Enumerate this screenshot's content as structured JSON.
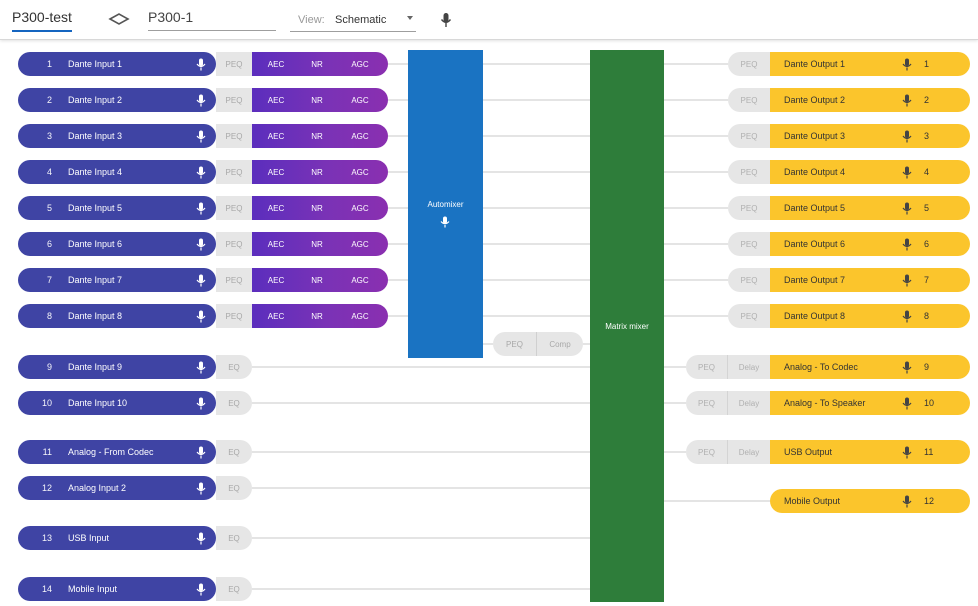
{
  "topbar": {
    "device": "P300-test",
    "name": "P300-1",
    "view_label": "View:",
    "view_value": "Schematic"
  },
  "colors": {
    "input": "#3f44a4",
    "fx": "#7a32b6",
    "automixer": "#1a73c2",
    "matrix": "#2e7d3a",
    "output": "#fbc52c"
  },
  "inputs": [
    {
      "num": "1",
      "name": "Dante Input 1",
      "proc": "PEQ"
    },
    {
      "num": "2",
      "name": "Dante Input 2",
      "proc": "PEQ"
    },
    {
      "num": "3",
      "name": "Dante Input 3",
      "proc": "PEQ"
    },
    {
      "num": "4",
      "name": "Dante Input 4",
      "proc": "PEQ"
    },
    {
      "num": "5",
      "name": "Dante Input 5",
      "proc": "PEQ"
    },
    {
      "num": "6",
      "name": "Dante Input 6",
      "proc": "PEQ"
    },
    {
      "num": "7",
      "name": "Dante Input 7",
      "proc": "PEQ"
    },
    {
      "num": "8",
      "name": "Dante Input 8",
      "proc": "PEQ"
    },
    {
      "num": "9",
      "name": "Dante Input 9",
      "proc": "EQ"
    },
    {
      "num": "10",
      "name": "Dante Input 10",
      "proc": "EQ"
    },
    {
      "num": "11",
      "name": "Analog - From Codec",
      "proc": "EQ"
    },
    {
      "num": "12",
      "name": "Analog Input 2",
      "proc": "EQ"
    },
    {
      "num": "13",
      "name": "USB Input",
      "proc": "EQ"
    },
    {
      "num": "14",
      "name": "Mobile Input",
      "proc": "EQ"
    }
  ],
  "fx": {
    "aec": "AEC",
    "nr": "NR",
    "agc": "AGC"
  },
  "automixer": {
    "label": "Automixer"
  },
  "matrix": {
    "label": "Matrix mixer"
  },
  "mid_proc": {
    "peq": "PEQ",
    "comp": "Comp"
  },
  "outputs": [
    {
      "num": "1",
      "name": "Dante Output 1",
      "peq": "PEQ"
    },
    {
      "num": "2",
      "name": "Dante Output 2",
      "peq": "PEQ"
    },
    {
      "num": "3",
      "name": "Dante Output 3",
      "peq": "PEQ"
    },
    {
      "num": "4",
      "name": "Dante Output 4",
      "peq": "PEQ"
    },
    {
      "num": "5",
      "name": "Dante Output 5",
      "peq": "PEQ"
    },
    {
      "num": "6",
      "name": "Dante Output 6",
      "peq": "PEQ"
    },
    {
      "num": "7",
      "name": "Dante Output 7",
      "peq": "PEQ"
    },
    {
      "num": "8",
      "name": "Dante Output 8",
      "peq": "PEQ"
    },
    {
      "num": "9",
      "name": "Analog - To Codec",
      "peq": "PEQ",
      "delay": "Delay"
    },
    {
      "num": "10",
      "name": "Analog - To Speaker",
      "peq": "PEQ",
      "delay": "Delay"
    },
    {
      "num": "11",
      "name": "USB Output",
      "peq": "PEQ",
      "delay": "Delay"
    },
    {
      "num": "12",
      "name": "Mobile Output"
    }
  ]
}
